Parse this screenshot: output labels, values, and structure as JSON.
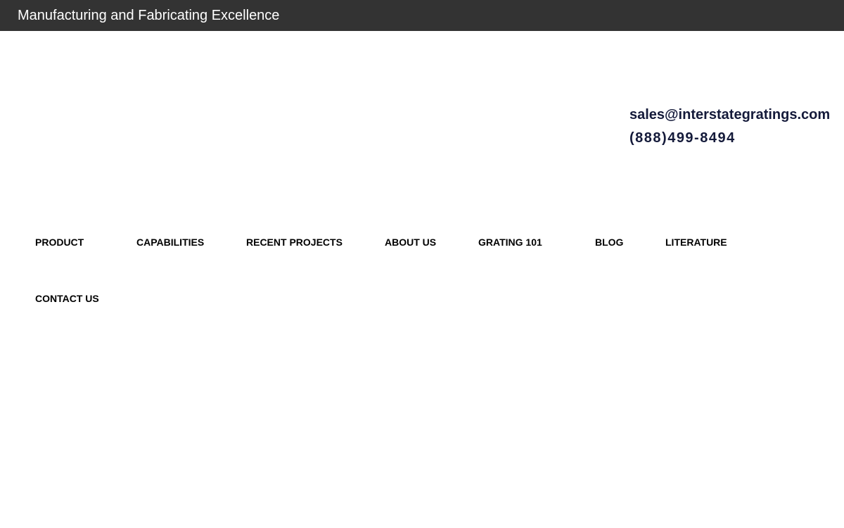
{
  "header": {
    "tagline": "Manufacturing and Fabricating Excellence"
  },
  "contact": {
    "email": "sales@interstategratings.com",
    "phone": "(888)499-8494"
  },
  "nav": {
    "items": [
      {
        "label": "PRODUCT"
      },
      {
        "label": "CAPABILITIES"
      },
      {
        "label": "RECENT PROJECTS"
      },
      {
        "label": "ABOUT US"
      },
      {
        "label": "GRATING 101"
      },
      {
        "label": "BLOG"
      },
      {
        "label": "LITERATURE"
      },
      {
        "label": "CONTACT US"
      }
    ]
  },
  "colors": {
    "top_bar": "#333333",
    "contact_text": "#141a3a",
    "nav_text": "#000000"
  }
}
